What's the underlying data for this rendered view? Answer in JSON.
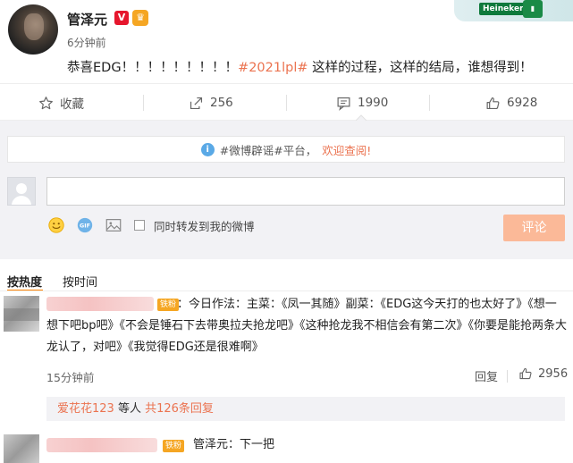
{
  "post": {
    "author": "管泽元",
    "verified_badge": "V",
    "time": "6分钟前",
    "text_prefix": "恭喜EDG！！！！！！！！！",
    "hashtag": "#2021lpl#",
    "text_suffix": " 这样的过程，这样的结局，谁想得到！",
    "ad_brand": "Heineken"
  },
  "actions": {
    "favorite": "收藏",
    "repost_count": "256",
    "comment_count": "1990",
    "like_count": "6928"
  },
  "composer": {
    "notice_text": "#微博辟谣#平台，",
    "notice_link": "欢迎查阅!",
    "forward_label": "同时转发到我的微博",
    "submit_label": "评论"
  },
  "sort": {
    "hot": "按热度",
    "time": "按时间"
  },
  "comments": [
    {
      "badge": "铁粉",
      "text": "：今日作法：主菜：《凤一其随》副菜：《EDG这今天打的也太好了》《想一想下吧bp吧》《不会是锤石下去带奥拉夫抢龙吧》《这种抢龙我不相信会有第二次》《你要是能抢两条大龙认了，对吧》《我觉得EDG还是很难啊》",
      "time": "15分钟前",
      "reply_label": "回复",
      "likes": "2956",
      "replies": {
        "who": "爱花花123",
        "mid": " 等人 ",
        "count": "共126条回复"
      }
    },
    {
      "badge": "铁粉",
      "text": "管泽元：下一把"
    }
  ],
  "colors": {
    "accent": "#eb7350",
    "submit_bg": "#fbb998",
    "sort_underline": "#ff8200",
    "composer_bg": "#f2f2f5"
  }
}
